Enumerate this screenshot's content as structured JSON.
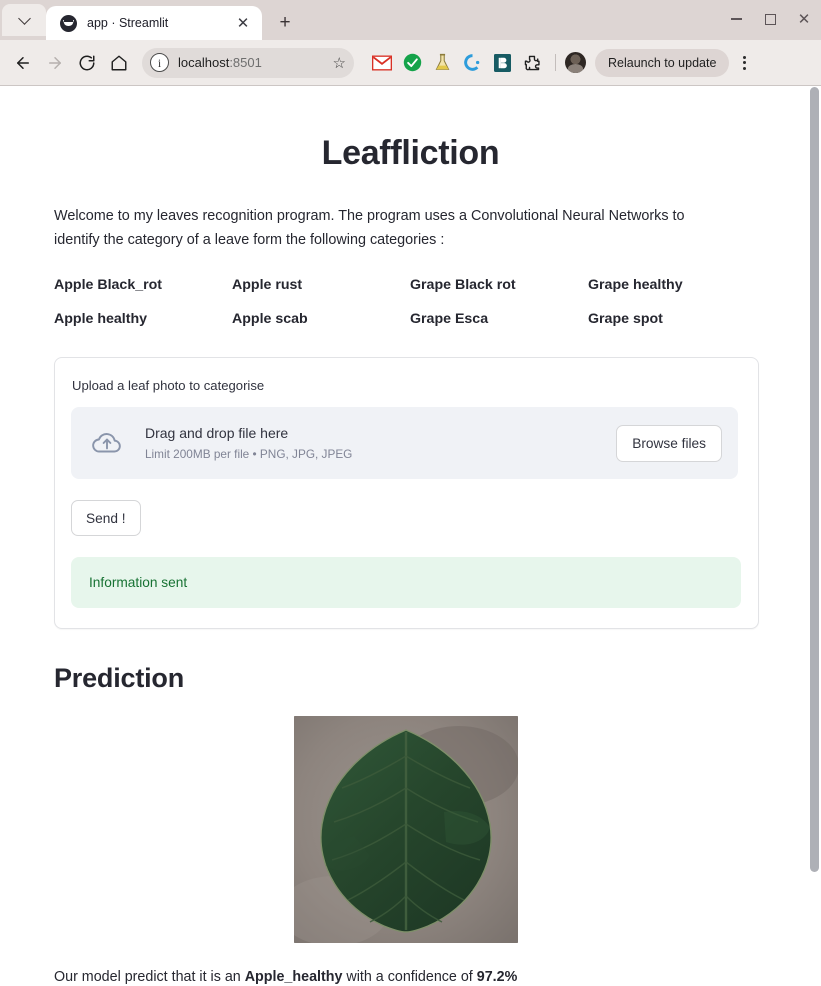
{
  "browser": {
    "tab": {
      "title": "app · Streamlit",
      "favicon": "streamlit-favicon",
      "close_label": "✕"
    },
    "new_tab_label": "+",
    "tab_list_chevron": "chevron-down-icon",
    "window_controls": {
      "minimize": "minimize-icon",
      "maximize": "maximize-icon",
      "close": "✕"
    },
    "nav": {
      "back": "◀",
      "forward": "▶",
      "reload": "reload-icon",
      "home": "home-icon"
    },
    "omnibox": {
      "site_info_icon": "info-circle-icon",
      "host": "localhost",
      "port": ":8501",
      "bookmark_icon": "star-icon"
    },
    "extensions": [
      {
        "name": "gmail-extension-icon",
        "glyph": "M",
        "color": "#d93025"
      },
      {
        "name": "checkmark-extension-icon",
        "glyph": "✔",
        "color": "#15a34a"
      },
      {
        "name": "flask-extension-icon",
        "glyph": "⚗",
        "color": "#c9a227"
      },
      {
        "name": "crescent-extension-icon",
        "glyph": "◖",
        "color": "#2d9cdb"
      },
      {
        "name": "bitwarden-extension-icon",
        "glyph": "B",
        "color": "#175b63"
      },
      {
        "name": "puzzle-extensions-icon",
        "glyph": "⬠",
        "color": "#1f1f1f"
      }
    ],
    "profile_avatar": "user-avatar",
    "relaunch_label": "Relaunch to update",
    "menu_icon": "kebab-menu-icon"
  },
  "app": {
    "title": "Leaffliction",
    "intro": "Welcome to my leaves recognition program. The program uses a Convolutional Neural Networks to identify the category of a leave form the following categories :",
    "categories": [
      "Apple Black_rot",
      "Apple rust",
      "Grape Black rot",
      "Grape healthy",
      "Apple healthy",
      "Apple scab",
      "Grape Esca",
      "Grape spot"
    ],
    "uploader": {
      "label": "Upload a leaf photo to categorise",
      "icon": "cloud-upload-icon",
      "drop_title": "Drag and drop file here",
      "drop_limit": "Limit 200MB per file • PNG, JPG, JPEG",
      "browse_label": "Browse files"
    },
    "send_label": "Send !",
    "alert": {
      "text": "Information sent",
      "bg": "#e7f6ec",
      "fg": "#177233"
    },
    "prediction": {
      "heading": "Prediction",
      "image_alt": "uploaded-leaf-photo",
      "result_prefix": "Our model predict that it is an ",
      "result_class": "Apple_healthy",
      "result_middle": " with a confidence of ",
      "result_confidence": "97.2%"
    }
  }
}
